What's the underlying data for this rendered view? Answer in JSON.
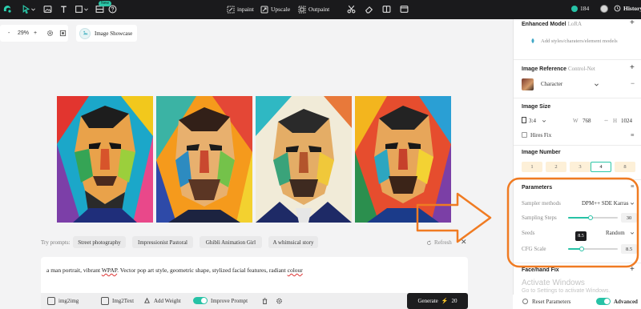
{
  "topbar": {
    "badge_new": "New",
    "inpaint_label": "inpaint",
    "upscale_label": "Upscale",
    "outpaint_label": "Outpaint",
    "credits": "184",
    "history_label": "History",
    "icons": [
      "logo-icon",
      "select-tool-icon",
      "chevron-down-icon",
      "image-icon",
      "text-tool-icon",
      "shape-tool-icon",
      "chevron-down-icon",
      "film-icon",
      "help-icon",
      "scissors-icon",
      "eraser-icon",
      "layout-icon",
      "window-icon"
    ]
  },
  "canvas": {
    "zoom_minus": "-",
    "zoom_value": "29%",
    "zoom_plus": "+",
    "showcase_label": "Image Showcase"
  },
  "prompt_suggestions": {
    "label": "Try prompts:",
    "chips": [
      "Street photography",
      "Impressionist Pastoral",
      "Ghibli Animation Girl",
      "A whimsical story"
    ],
    "refresh_label": "Refresh",
    "close": "✕"
  },
  "prompt": {
    "text_before": "a man portrait, vibrant ",
    "text_flag1": "WPAP",
    "text_middle": ". Vector pop art style, geometric shape, stylized facial features, radiant ",
    "text_flag2": "colour"
  },
  "bottom_toolbar": {
    "img2img_label": "img2img",
    "img2text_label": "Img2Text",
    "add_weight_label": "Add Weight",
    "improve_prompt_label": "Improve Prompt",
    "generate_label": "Generate",
    "generate_cost": "20"
  },
  "panel": {
    "enhanced_model": {
      "title": "Enhanced Model",
      "subtitle": "LoRA",
      "placeholder": "Add styles/charaters/element models"
    },
    "image_reference": {
      "title": "Image Reference",
      "subtitle": "Control-Net",
      "character_label": "Character"
    },
    "image_size": {
      "title": "Image Size",
      "ratio": "3:4",
      "w_label": "W",
      "w_value": "768",
      "link": "⇔",
      "h_label": "H",
      "h_value": "1024",
      "hires_label": "Hires Fix"
    },
    "image_number": {
      "title": "Image Number",
      "options": [
        "1",
        "2",
        "3",
        "4",
        "8"
      ],
      "selected": "4"
    },
    "parameters": {
      "title": "Parameters",
      "sampler_label": "Sampler methods",
      "sampler_value": "DPM++ SDE Karras",
      "steps_label": "Sampling Steps",
      "steps_value": "30",
      "steps_fraction": 0.45,
      "seeds_label": "Seeds",
      "seeds_value": "Random",
      "cfg_label": "CFG Scale",
      "cfg_value": "8.5",
      "cfg_fraction": 0.27,
      "cfg_tooltip": "8.5"
    },
    "face_hand_fix": {
      "title": "Face/hand Fix"
    },
    "reset_label": "Reset Parameters",
    "advanced_label": "Advanced"
  },
  "watermark": {
    "line1": "Activate Windows",
    "line2": "Go to Settings to activate Windows."
  },
  "colors": {
    "accent": "#27c2a6",
    "annotation": "#f07b22",
    "topbar": "#1a1a1c"
  }
}
